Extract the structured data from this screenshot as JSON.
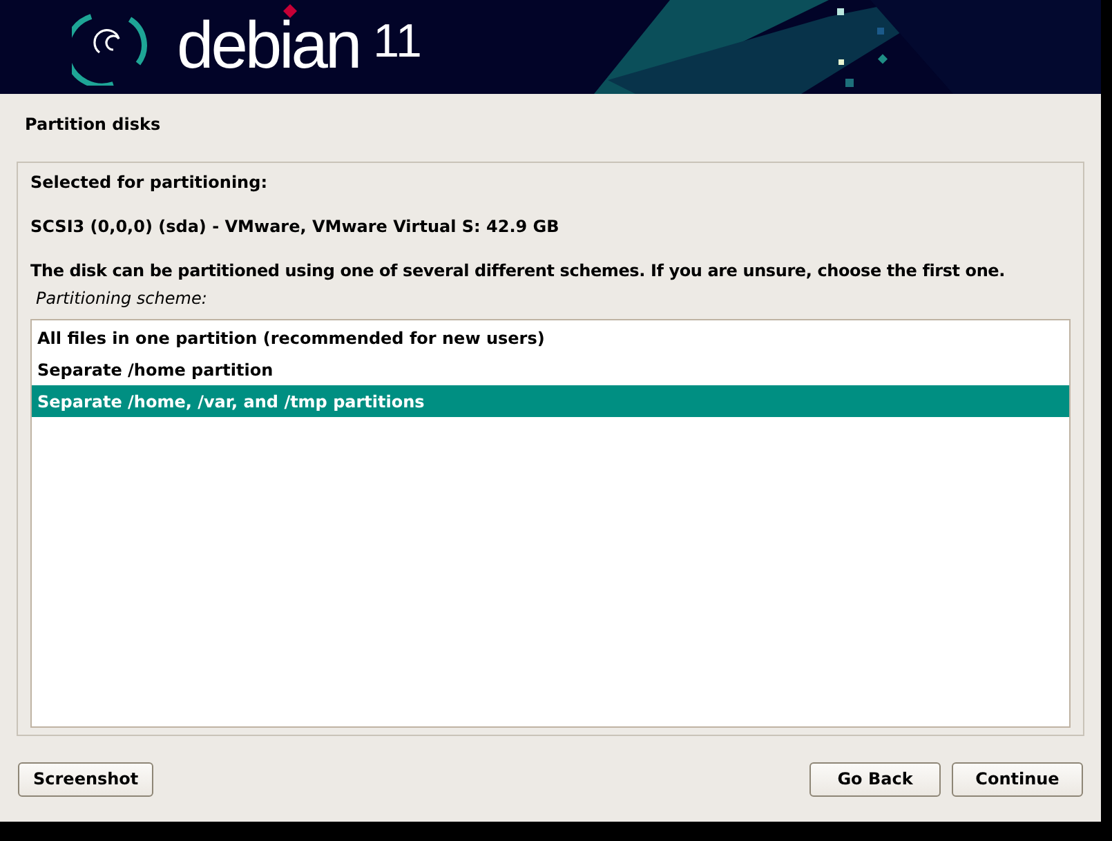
{
  "banner": {
    "logo_text": "debian",
    "version": "11"
  },
  "title": "Partition disks",
  "selected_label": "Selected for partitioning:",
  "disk": "SCSI3 (0,0,0) (sda) - VMware, VMware Virtual S: 42.9 GB",
  "description": "The disk can be partitioned using one of several different schemes. If you are unsure, choose the first one.",
  "list_label": "Partitioning scheme:",
  "options": [
    {
      "label": "All files in one partition (recommended for new users)",
      "selected": false
    },
    {
      "label": "Separate /home partition",
      "selected": false
    },
    {
      "label": "Separate /home, /var, and /tmp partitions",
      "selected": true
    }
  ],
  "buttons": {
    "left": [
      "Screenshot"
    ],
    "right": [
      "Go Back",
      "Continue"
    ]
  }
}
